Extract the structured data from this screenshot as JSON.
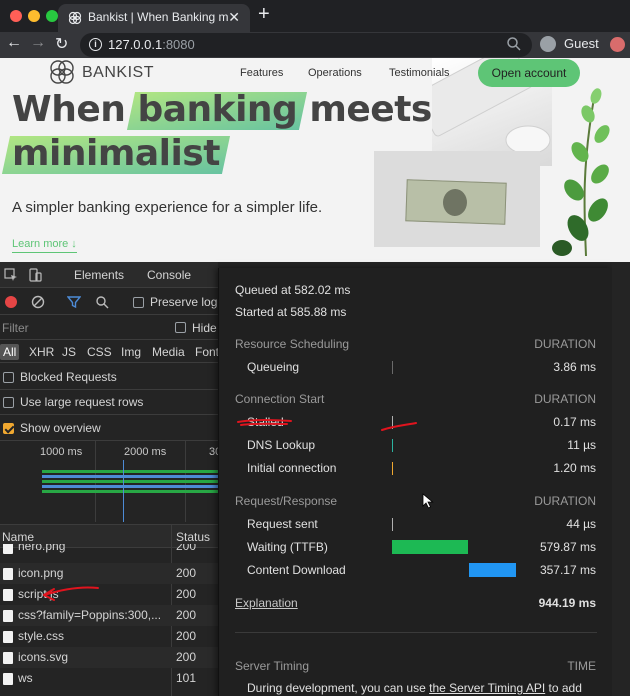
{
  "browser": {
    "tab_title": "Bankist | When Banking meets minimalist",
    "tab_close": "✕",
    "new_tab": "+",
    "url_host": "127.0.0.1",
    "url_port": ":8080",
    "profile_label": "Guest",
    "back": "←",
    "forward": "→",
    "reload": "↻"
  },
  "site": {
    "logo_text": "BANKIST",
    "nav": [
      "Features",
      "Operations",
      "Testimonials"
    ],
    "cta": "Open account",
    "hero_word1": "When",
    "hero_word2": "banking",
    "hero_word3": "meets",
    "hero_word4": "minimalist",
    "subtitle": "A simpler banking experience for a simpler life.",
    "learn_more": "Learn more ↓"
  },
  "devtools": {
    "tabs": [
      "Elements",
      "Console"
    ],
    "preserve_log": "Preserve log",
    "filter_placeholder": "Filter",
    "hide_label": "Hide",
    "types": [
      "All",
      "XHR",
      "JS",
      "CSS",
      "Img",
      "Media",
      "Font"
    ],
    "blocked_requests": "Blocked Requests",
    "large_rows": "Use large request rows",
    "show_overview": "Show overview",
    "show_overview_checked": true,
    "overview_ticks": [
      "1000 ms",
      "2000 ms",
      "30"
    ],
    "columns": {
      "name": "Name",
      "status": "Status"
    },
    "requests": [
      {
        "name": "hero.png",
        "status": "200",
        "icon": "image-file-icon"
      },
      {
        "name": "icon.png",
        "status": "200",
        "icon": "file-icon"
      },
      {
        "name": "script.js",
        "status": "200",
        "icon": "file-icon"
      },
      {
        "name": "css?family=Poppins:300,...",
        "status": "200",
        "icon": "file-icon"
      },
      {
        "name": "style.css",
        "status": "200",
        "icon": "file-icon"
      },
      {
        "name": "icons.svg",
        "status": "200",
        "icon": "file-icon"
      },
      {
        "name": "ws",
        "status": "101",
        "icon": "file-icon"
      }
    ]
  },
  "timing": {
    "queued": "Queued at 582.02 ms",
    "started": "Started at 585.88 ms",
    "duration_label": "DURATION",
    "sections": {
      "scheduling": "Resource Scheduling",
      "connection": "Connection Start",
      "request": "Request/Response"
    },
    "rows": {
      "queueing": {
        "label": "Queueing",
        "value": "3.86 ms"
      },
      "stalled": {
        "label": "Stalled",
        "value": "0.17 ms"
      },
      "dns": {
        "label": "DNS Lookup",
        "value": "11 µs"
      },
      "initial": {
        "label": "Initial connection",
        "value": "1.20 ms"
      },
      "sent": {
        "label": "Request sent",
        "value": "44 µs"
      },
      "waiting": {
        "label": "Waiting (TTFB)",
        "value": "579.87 ms"
      },
      "download": {
        "label": "Content Download",
        "value": "357.17 ms"
      }
    },
    "explanation": "Explanation",
    "total": "944.19 ms",
    "server_timing": "Server Timing",
    "time_label": "TIME",
    "note_prefix": "During development, you can use ",
    "note_link": "the Server Timing API",
    "note_suffix": " to add"
  },
  "colors": {
    "accent_green": "#5ec576",
    "waiting_bar": "#1db954",
    "download_bar": "#2196f3",
    "annotation_red": "#e0141e",
    "record_red": "#e54545",
    "checkbox_orange": "#f0a830"
  }
}
